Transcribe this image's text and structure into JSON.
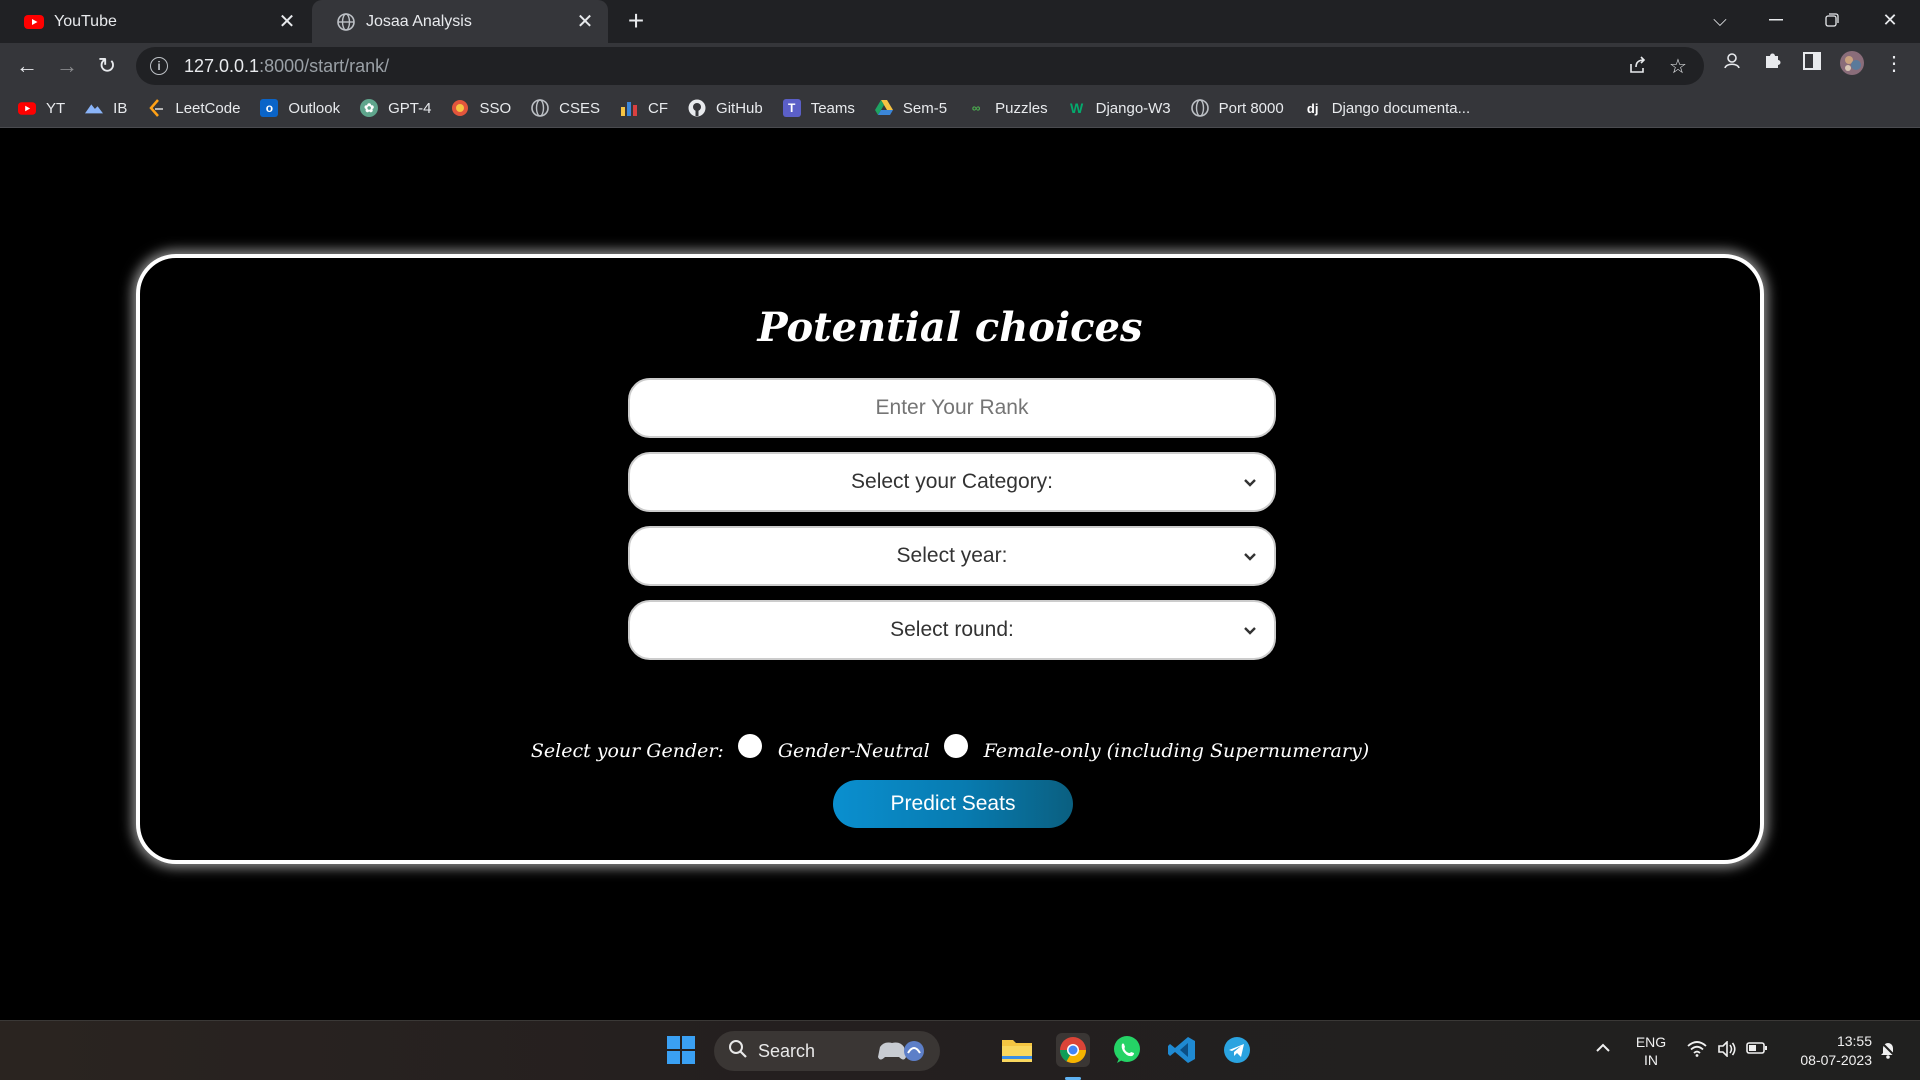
{
  "browser": {
    "tabs": [
      {
        "title": "YouTube",
        "icon": "youtube-icon",
        "active": false
      },
      {
        "title": "Josaa Analysis",
        "icon": "globe-icon",
        "active": true
      }
    ],
    "url_host": "127.0.0.1",
    "url_path": ":8000/start/rank/",
    "bookmarks": [
      {
        "label": "YT",
        "icon": "youtube-icon"
      },
      {
        "label": "IB",
        "icon": "mountain-icon"
      },
      {
        "label": "LeetCode",
        "icon": "leetcode-icon"
      },
      {
        "label": "Outlook",
        "icon": "outlook-icon"
      },
      {
        "label": "GPT-4",
        "icon": "openai-icon"
      },
      {
        "label": "SSO",
        "icon": "sso-icon"
      },
      {
        "label": "CSES",
        "icon": "globe-icon"
      },
      {
        "label": "CF",
        "icon": "codeforces-icon"
      },
      {
        "label": "GitHub",
        "icon": "github-icon"
      },
      {
        "label": "Teams",
        "icon": "teams-icon"
      },
      {
        "label": "Sem-5",
        "icon": "drive-icon"
      },
      {
        "label": "Puzzles",
        "icon": "puzzles-icon"
      },
      {
        "label": "Django-W3",
        "icon": "w3-icon"
      },
      {
        "label": "Port 8000",
        "icon": "globe-icon"
      },
      {
        "label": "Django documenta...",
        "icon": "django-icon"
      }
    ],
    "colors": {
      "tabbar": "#202124",
      "toolbar": "#35363a"
    }
  },
  "page": {
    "heading": "Potential choices",
    "rank_placeholder": "Enter Your Rank",
    "category_select": "Select your Category:",
    "year_select": "Select year:",
    "round_select": "Select round:",
    "gender_label": "Select your Gender:",
    "gender_options": [
      "Gender-Neutral",
      "Female-only (including Supernumerary)"
    ],
    "predict_button": "Predict Seats",
    "colors": {
      "button_start": "#0a8fcf",
      "button_end": "#0a5f80"
    }
  },
  "taskbar": {
    "search_label": "Search",
    "apps": [
      "windows-start-icon",
      "game-controller-icon",
      "file-explorer-icon",
      "chrome-icon",
      "whatsapp-icon",
      "vscode-icon",
      "telegram-icon"
    ],
    "lang_top": "ENG",
    "lang_bottom": "IN",
    "time": "13:55",
    "date": "08-07-2023"
  }
}
